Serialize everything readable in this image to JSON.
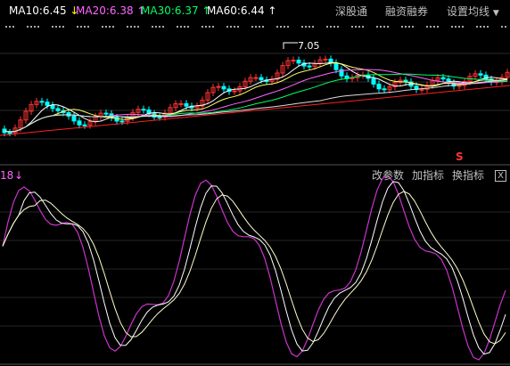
{
  "top_panel": {
    "ma_legend": [
      {
        "label": "MA10:6.45",
        "arrow": "↓",
        "color": "#ffffff",
        "arrow_color": "#ffff00"
      },
      {
        "label": "MA20:6.38",
        "arrow": "↑",
        "color": "#ff66ff",
        "arrow_color": "#ff66ff"
      },
      {
        "label": "MA30:6.37",
        "arrow": "↑",
        "color": "#00ff66",
        "arrow_color": "#00ff66"
      },
      {
        "label": "MA60:6.44",
        "arrow": "↑",
        "color": "#ffffff",
        "arrow_color": "#ffffff"
      }
    ],
    "toolbar": {
      "shenzhen": "深股通",
      "margin": "融资融券",
      "ma_settings": "设置均线"
    },
    "peak_label": "7.05",
    "signal_mark": "S"
  },
  "bottom_panel": {
    "indicator_partial": "18",
    "indicator_arrow": "↓",
    "buttons": {
      "change_params": "改参数",
      "add_indicator": "加指标",
      "switch_indicator": "换指标",
      "close": "X"
    }
  },
  "colors": {
    "up": "#ff3333",
    "down": "#00ffff",
    "kline_line": "#ffffff",
    "trend_line": "#ff2222",
    "osc_fast": "#cc33cc",
    "osc_slow": "#ffffcc",
    "osc_mid": "#ffffff"
  }
}
